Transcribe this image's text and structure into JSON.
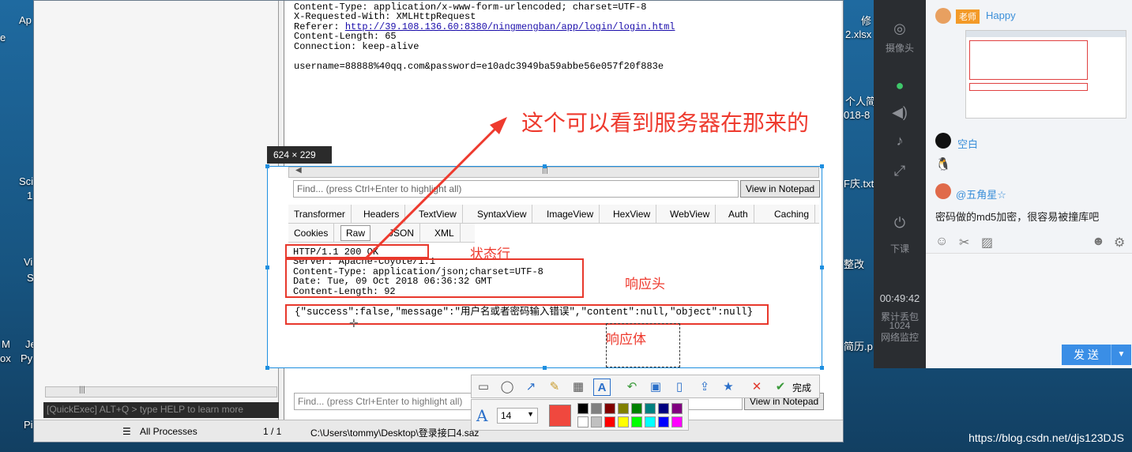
{
  "desktop": {
    "icon_labels": [
      "e",
      "Ap",
      "Sci",
      "1",
      "Vi",
      "S",
      "M",
      "Je",
      "ox",
      "Py",
      "Pi",
      "修",
      "2.xlsx",
      "个人简",
      "018-8",
      "F庆.txt",
      "整改",
      "简历.p"
    ]
  },
  "fiddler": {
    "request_lines": [
      "Content-Type: application/x-www-form-urlencoded; charset=UTF-8",
      "X-Requested-With: XMLHttpRequest",
      "Referer: ",
      "Content-Length: 65",
      "Connection: keep-alive",
      "",
      "username=88888%40qq.com&password=e10adc3949ba59abbe56e057f20f883e"
    ],
    "referer_url": "http://39.108.136.60:8380/ningmengban/app/login/login.html",
    "quickexec": "[QuickExec] ALT+Q > type HELP to learn more",
    "status_filter": "All Processes",
    "status_count": "1 / 1",
    "status_path": "C:\\Users\\tommy\\Desktop\\登录接口4.saz",
    "find_placeholder": "Find... (press Ctrl+Enter to highlight all)",
    "view_notepad": "View in Notepad"
  },
  "capture": {
    "dimensions": "624 × 229",
    "find_placeholder": "Find... (press Ctrl+Enter to highlight all)",
    "view_notepad": "View in Notepad",
    "tabs_row1": [
      "Transformer",
      "Headers",
      "TextView",
      "SyntaxView",
      "ImageView",
      "HexView",
      "WebView",
      "Auth",
      "Caching"
    ],
    "tabs_row2": [
      "Cookies",
      "Raw",
      "JSON",
      "XML"
    ],
    "status_line": "HTTP/1.1 200 OK",
    "header_lines": [
      "Server: Apache-Coyote/1.1",
      "Content-Type: application/json;charset=UTF-8",
      "Date: Tue, 09 Oct 2018 06:36:32 GMT",
      "Content-Length: 92"
    ],
    "body": "{\"success\":false,\"message\":\"用户名或者密码输入错误\",\"content\":null,\"object\":null}"
  },
  "annotations": {
    "server_note": "这个可以看到服务器在那来的",
    "status_label": "状态行",
    "header_label": "响应头",
    "body_label": "响应体"
  },
  "toolbar": {
    "done_label": "完成",
    "font_size": "14",
    "current_color": "#f0483e",
    "palette": [
      "#000000",
      "#808080",
      "#800000",
      "#808000",
      "#008000",
      "#008080",
      "#000080",
      "#800080",
      "#ffffff",
      "#c0c0c0",
      "#ff0000",
      "#ffff00",
      "#00ff00",
      "#00ffff",
      "#0000ff",
      "#ff00ff"
    ]
  },
  "qq": {
    "side_labels": [
      "摄像头",
      "下课",
      "00:49:42",
      "累计丢包",
      "1024",
      "网络监控"
    ],
    "messages": [
      {
        "badge": "老师",
        "name": "Happy"
      },
      {
        "name": "空白"
      },
      {
        "name": "@五角星☆"
      }
    ],
    "last_message": "密码做的md5加密，很容易被撞库吧",
    "send_label": "发 送",
    "send_dropdown": "▼"
  },
  "watermark": "https://blog.csdn.net/djs123DJS"
}
